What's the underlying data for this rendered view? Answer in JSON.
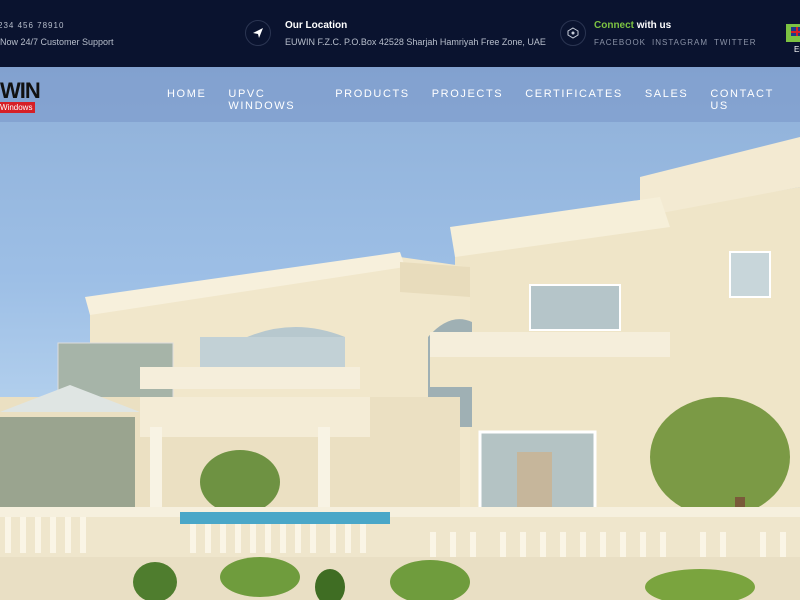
{
  "topbar": {
    "phone": "234 456 78910",
    "support": "Now 24/7 Customer Support",
    "location_title": "Our Location",
    "location_address": "EUWIN F.Z.C. P.O.Box 42528 Sharjah Hamriyah Free Zone, UAE",
    "connect_highlight": "Connect",
    "connect_rest": "with us",
    "social": [
      "FACEBOOK",
      "INSTAGRAM",
      "TWITTER"
    ],
    "language": "En"
  },
  "logo": {
    "text": "WIN",
    "sub": "Windows"
  },
  "nav": {
    "items": [
      "HOME",
      "UPVC WINDOWS",
      "PRODUCTS",
      "PROJECTS",
      "CERTIFICATES",
      "SALES",
      "CONTACT US"
    ]
  },
  "colors": {
    "topbar": "#0a132f",
    "accent": "#7cc242",
    "brand_red": "#d61f26"
  }
}
